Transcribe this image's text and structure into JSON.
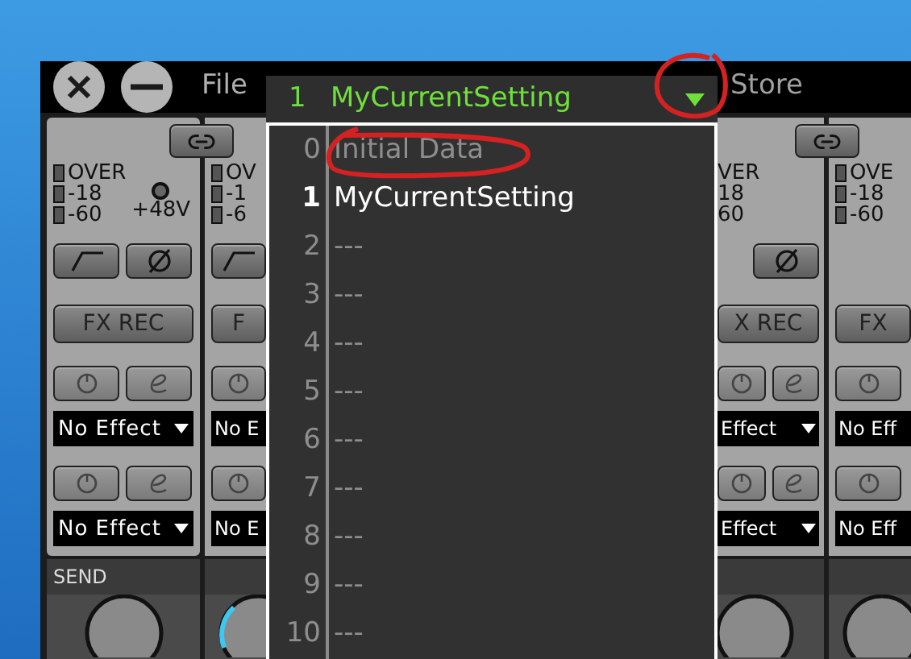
{
  "window_buttons": [
    {
      "kind": "close"
    },
    {
      "kind": "minimize"
    }
  ],
  "menu": {
    "file": "File",
    "store": "Store"
  },
  "preset_selector": {
    "number": "1",
    "name": "MyCurrentSetting",
    "expanded": true
  },
  "preset_list": [
    {
      "number": "0",
      "name": "Initial Data",
      "selected": false
    },
    {
      "number": "1",
      "name": "MyCurrentSetting",
      "selected": true
    },
    {
      "number": "2",
      "name": "---",
      "selected": false
    },
    {
      "number": "3",
      "name": "---",
      "selected": false
    },
    {
      "number": "4",
      "name": "---",
      "selected": false
    },
    {
      "number": "5",
      "name": "---",
      "selected": false
    },
    {
      "number": "6",
      "name": "---",
      "selected": false
    },
    {
      "number": "7",
      "name": "---",
      "selected": false
    },
    {
      "number": "8",
      "name": "---",
      "selected": false
    },
    {
      "number": "9",
      "name": "---",
      "selected": false
    },
    {
      "number": "10",
      "name": "---",
      "selected": false
    }
  ],
  "strips": [
    {
      "kind": "full",
      "meter_labels": [
        "OVER",
        "-18",
        "-60"
      ],
      "phantom": "+48V",
      "buttons": [
        {
          "kind": "hpf"
        },
        {
          "kind": "phase"
        }
      ],
      "fx_rec": "FX REC",
      "slots": [
        {
          "buttons": [
            {
              "kind": "power"
            },
            {
              "kind": "edit"
            }
          ],
          "label": "No Effect",
          "arrow": true
        },
        {
          "buttons": [
            {
              "kind": "power"
            },
            {
              "kind": "edit"
            }
          ],
          "label": "No Effect",
          "arrow": true
        }
      ],
      "send": "SEND"
    },
    {
      "kind": "left",
      "meter_labels": [
        "OV",
        "-1",
        "-6"
      ],
      "buttons": [
        {
          "kind": "hpf"
        }
      ],
      "fx_rec": "F",
      "slots": [
        {
          "buttons": [
            {
              "kind": "power"
            }
          ],
          "label": "No E",
          "arrow": false
        },
        {
          "buttons": [
            {
              "kind": "power"
            }
          ],
          "label": "No E",
          "arrow": false
        }
      ]
    },
    {
      "kind": "right",
      "meter_labels": [
        "VER",
        "18",
        "60"
      ],
      "buttons": [
        {
          "kind": "phase"
        }
      ],
      "fx_rec": "X REC",
      "slots": [
        {
          "buttons": [
            {
              "kind": "power"
            },
            {
              "kind": "edit"
            }
          ],
          "label": "Effect",
          "arrow": true
        },
        {
          "buttons": [
            {
              "kind": "power"
            },
            {
              "kind": "edit"
            }
          ],
          "label": "Effect",
          "arrow": true
        }
      ]
    },
    {
      "kind": "left",
      "meter_labels": [
        "OVE",
        "-18",
        "-60"
      ],
      "fx_rec": "FX",
      "slots": [
        {
          "buttons": [
            {
              "kind": "power"
            }
          ],
          "label": "No Eff",
          "arrow": false
        },
        {
          "buttons": [
            {
              "kind": "power"
            }
          ],
          "label": "No Eff",
          "arrow": false
        }
      ]
    }
  ]
}
